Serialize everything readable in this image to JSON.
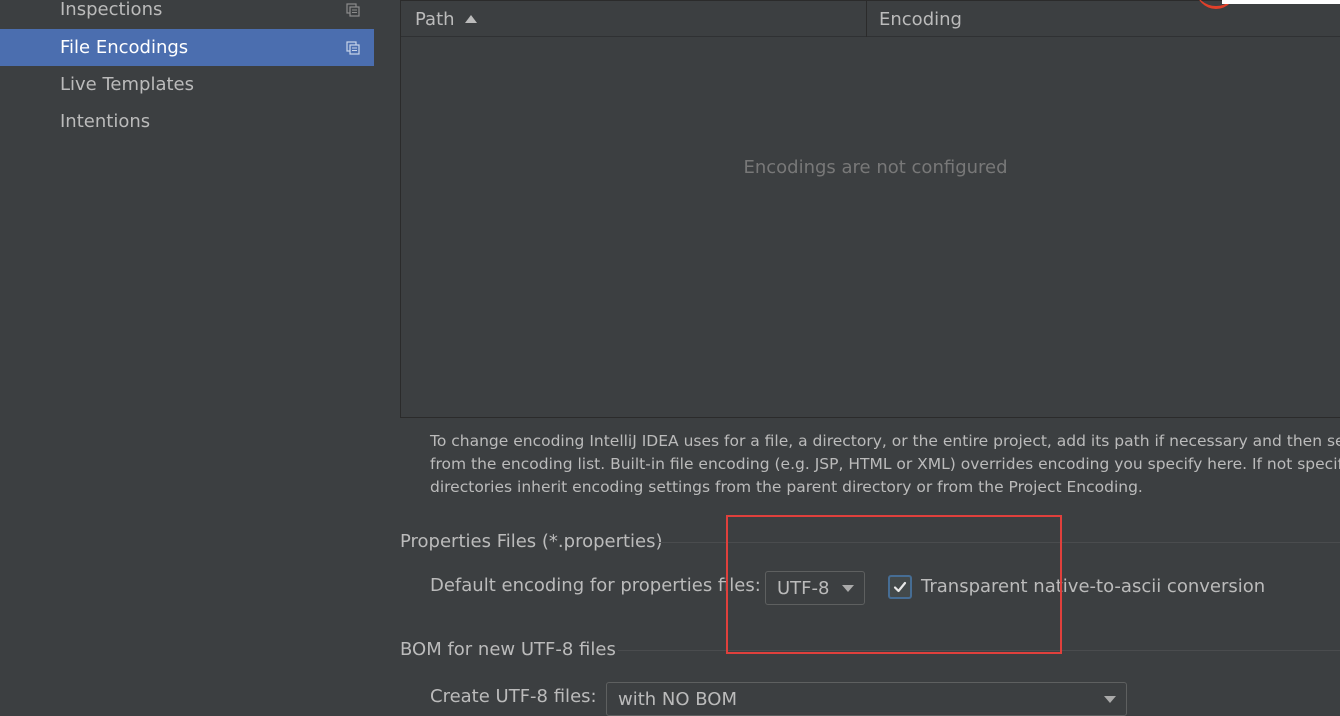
{
  "sidebar": {
    "items": [
      {
        "label": "Inspections",
        "has_copy_icon": true,
        "selected": false
      },
      {
        "label": "File Encodings",
        "has_copy_icon": true,
        "selected": true
      },
      {
        "label": "Live Templates",
        "has_copy_icon": false,
        "selected": false
      },
      {
        "label": "Intentions",
        "has_copy_icon": false,
        "selected": false
      }
    ]
  },
  "table": {
    "columns": [
      "Path",
      "Encoding"
    ],
    "sorted_column": "Path",
    "sort_direction": "ascending",
    "empty_message": "Encodings are not configured"
  },
  "help": {
    "lines": [
      "To change encoding IntelliJ IDEA uses for a file, a directory, or the entire project, add its path if necessary and then sele",
      "from the encoding list. Built-in file encoding (e.g. JSP, HTML or XML) overrides encoding you specify here. If not specifie",
      "directories inherit encoding settings from the parent directory or from the Project Encoding."
    ]
  },
  "properties_section": {
    "title": "Properties Files (*.properties)",
    "default_encoding_label": "Default encoding for properties files:",
    "default_encoding_value": "UTF-8",
    "native_to_ascii_label": "Transparent native-to-ascii conversion",
    "native_to_ascii_checked": true
  },
  "bom_section": {
    "title": "BOM for new UTF-8 files",
    "create_label": "Create UTF-8 files:",
    "create_value": "with NO BOM"
  },
  "colors": {
    "background": "#3c3f41",
    "selection": "#4b6eaf",
    "annotation_red": "#e0403c"
  }
}
